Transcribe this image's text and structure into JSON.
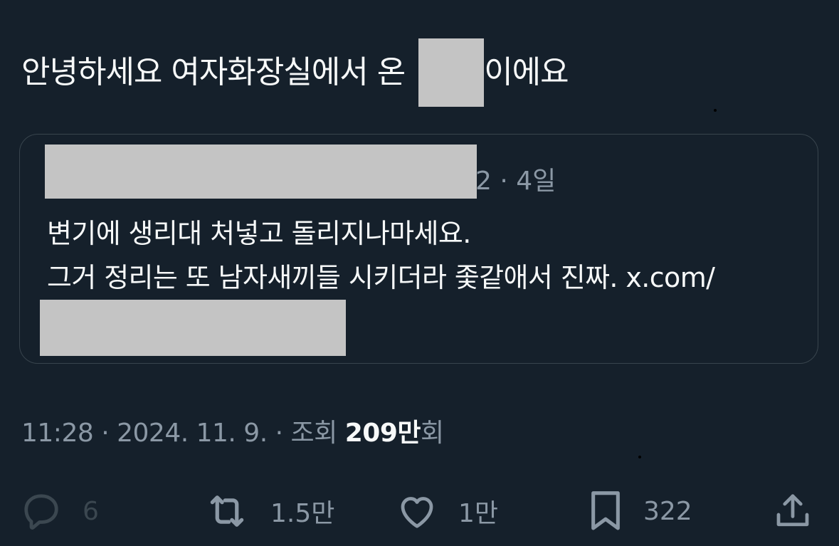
{
  "tweet": {
    "text_before": "안녕하세요 여자화장실에서 온 ",
    "text_after": "이에요"
  },
  "quote": {
    "time_suffix": "2 · 4일",
    "line1": "변기에 생리대 처넣고 돌리지나마세요.",
    "line2": "그거 정리는 또 남자새끼들 시키더라 좇같애서 진짜. x.com/"
  },
  "meta": {
    "time": "11:28",
    "date": "2024. 11. 9.",
    "views_label": "조회",
    "views_count": "209만",
    "views_suffix": "회",
    "sep": "·"
  },
  "actions": {
    "reply_count": "6",
    "retweet_count": "1.5만",
    "like_count": "1만",
    "bookmark_count": "322"
  },
  "icons": {
    "reply": "reply-icon",
    "retweet": "retweet-icon",
    "like": "heart-icon",
    "bookmark": "bookmark-icon",
    "share": "share-icon"
  },
  "colors": {
    "background": "#15202b",
    "text": "#f7f9f9",
    "secondary": "#8b98a5",
    "border": "#38444d",
    "redaction": "#c4c4c4"
  }
}
